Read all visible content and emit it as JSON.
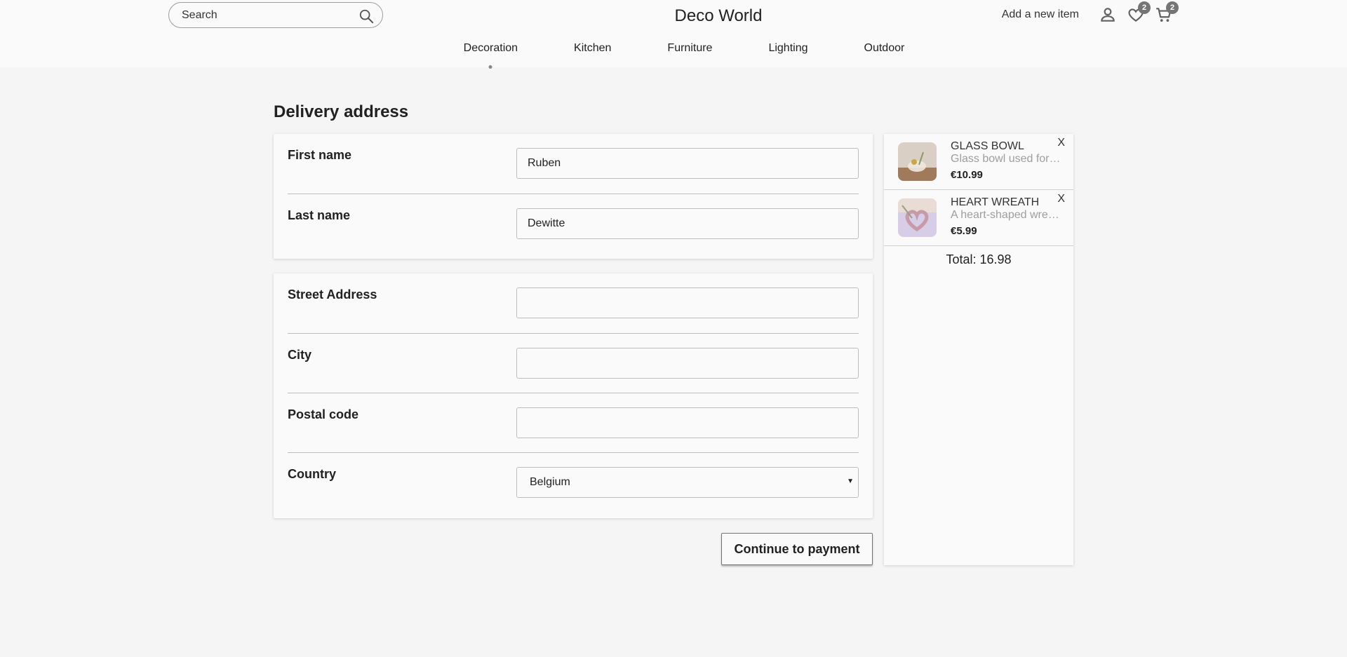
{
  "header": {
    "search_placeholder": "Search",
    "brand": "Deco World",
    "add_item_label": "Add a new item",
    "wishlist_count": "2",
    "cart_count": "2"
  },
  "nav": {
    "items": [
      {
        "label": "Decoration",
        "active": true
      },
      {
        "label": "Kitchen",
        "active": false
      },
      {
        "label": "Furniture",
        "active": false
      },
      {
        "label": "Lighting",
        "active": false
      },
      {
        "label": "Outdoor",
        "active": false
      }
    ]
  },
  "form": {
    "title": "Delivery address",
    "first_name": {
      "label": "First name",
      "value": "Ruben"
    },
    "last_name": {
      "label": "Last name",
      "value": "Dewitte"
    },
    "street": {
      "label": "Street Address",
      "value": ""
    },
    "city": {
      "label": "City",
      "value": ""
    },
    "postal": {
      "label": "Postal code",
      "value": ""
    },
    "country": {
      "label": "Country",
      "value": "Belgium"
    },
    "continue_label": "Continue to payment"
  },
  "cart": {
    "items": [
      {
        "name": "GLASS BOWL",
        "description": "Glass bowl used for decoration",
        "price": "€10.99",
        "remove": "X"
      },
      {
        "name": "HEART WREATH",
        "description": "A heart-shaped wreath",
        "price": "€5.99",
        "remove": "X"
      }
    ],
    "total": "Total: 16.98"
  },
  "colors": {
    "page_bg": "#f5f5f5",
    "card_bg": "#fafafa",
    "badge": "#757575"
  }
}
